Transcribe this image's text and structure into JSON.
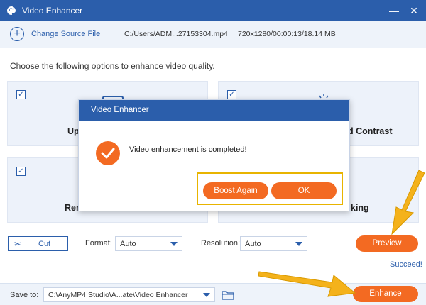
{
  "window": {
    "title": "Video Enhancer",
    "minimize_glyph": "—",
    "close_glyph": "✕"
  },
  "source": {
    "change_label": "Change Source File",
    "file_path": "C:/Users/ADM...27153304.mp4",
    "file_info": "720x1280/00:00:13/18.14 MB"
  },
  "instruction": "Choose the following options to enhance video quality.",
  "options": [
    {
      "label": "Up",
      "checked": true
    },
    {
      "label": "d Contrast",
      "checked": true
    },
    {
      "label": "Rem",
      "checked": true
    },
    {
      "label": "king",
      "checked": true
    }
  ],
  "controls": {
    "cut_label": "Cut",
    "format_label": "Format:",
    "format_value": "Auto",
    "resolution_label": "Resolution:",
    "resolution_value": "Auto",
    "preview_label": "Preview",
    "status_text": "Succeed!"
  },
  "footer": {
    "save_label": "Save to:",
    "save_path": "C:\\AnyMP4 Studio\\A...ate\\Video Enhancer",
    "enhance_label": "Enhance"
  },
  "modal": {
    "title": "Video Enhancer",
    "message": "Video enhancement is completed!",
    "boost_label": "Boost Again",
    "ok_label": "OK"
  },
  "colors": {
    "brand_blue": "#2b5eab",
    "accent_orange": "#f36a22",
    "highlight_yellow": "#e8b400",
    "annotation_arrow": "#f4b21b"
  },
  "icons": {
    "app": "palette-icon",
    "add": "plus-circle-icon",
    "cut": "scissors-icon",
    "folder": "folder-icon",
    "success": "check-circle-icon"
  }
}
